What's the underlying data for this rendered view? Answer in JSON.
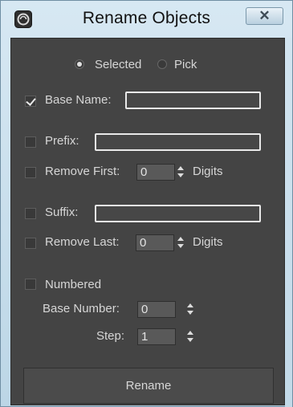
{
  "window": {
    "title": "Rename Objects",
    "close_glyph": "✕",
    "app_icon": "max-logo-icon"
  },
  "source": {
    "options": [
      {
        "label": "Selected",
        "selected": true
      },
      {
        "label": "Pick",
        "selected": false
      }
    ]
  },
  "base_name": {
    "label": "Base Name:",
    "checked": true,
    "value": ""
  },
  "prefix": {
    "label": "Prefix:",
    "checked": false,
    "value": ""
  },
  "remove_first": {
    "label": "Remove First:",
    "checked": false,
    "value": "0",
    "unit": "Digits"
  },
  "suffix": {
    "label": "Suffix:",
    "checked": false,
    "value": ""
  },
  "remove_last": {
    "label": "Remove Last:",
    "checked": false,
    "value": "0",
    "unit": "Digits"
  },
  "numbered": {
    "label": "Numbered",
    "checked": false,
    "base_number": {
      "label": "Base Number:",
      "value": "0"
    },
    "step": {
      "label": "Step:",
      "value": "1"
    }
  },
  "rename_button": {
    "label": "Rename"
  },
  "colors": {
    "panel_bg": "#444444",
    "titlebar": "#c8dceb",
    "text": "#d6d6d6"
  }
}
